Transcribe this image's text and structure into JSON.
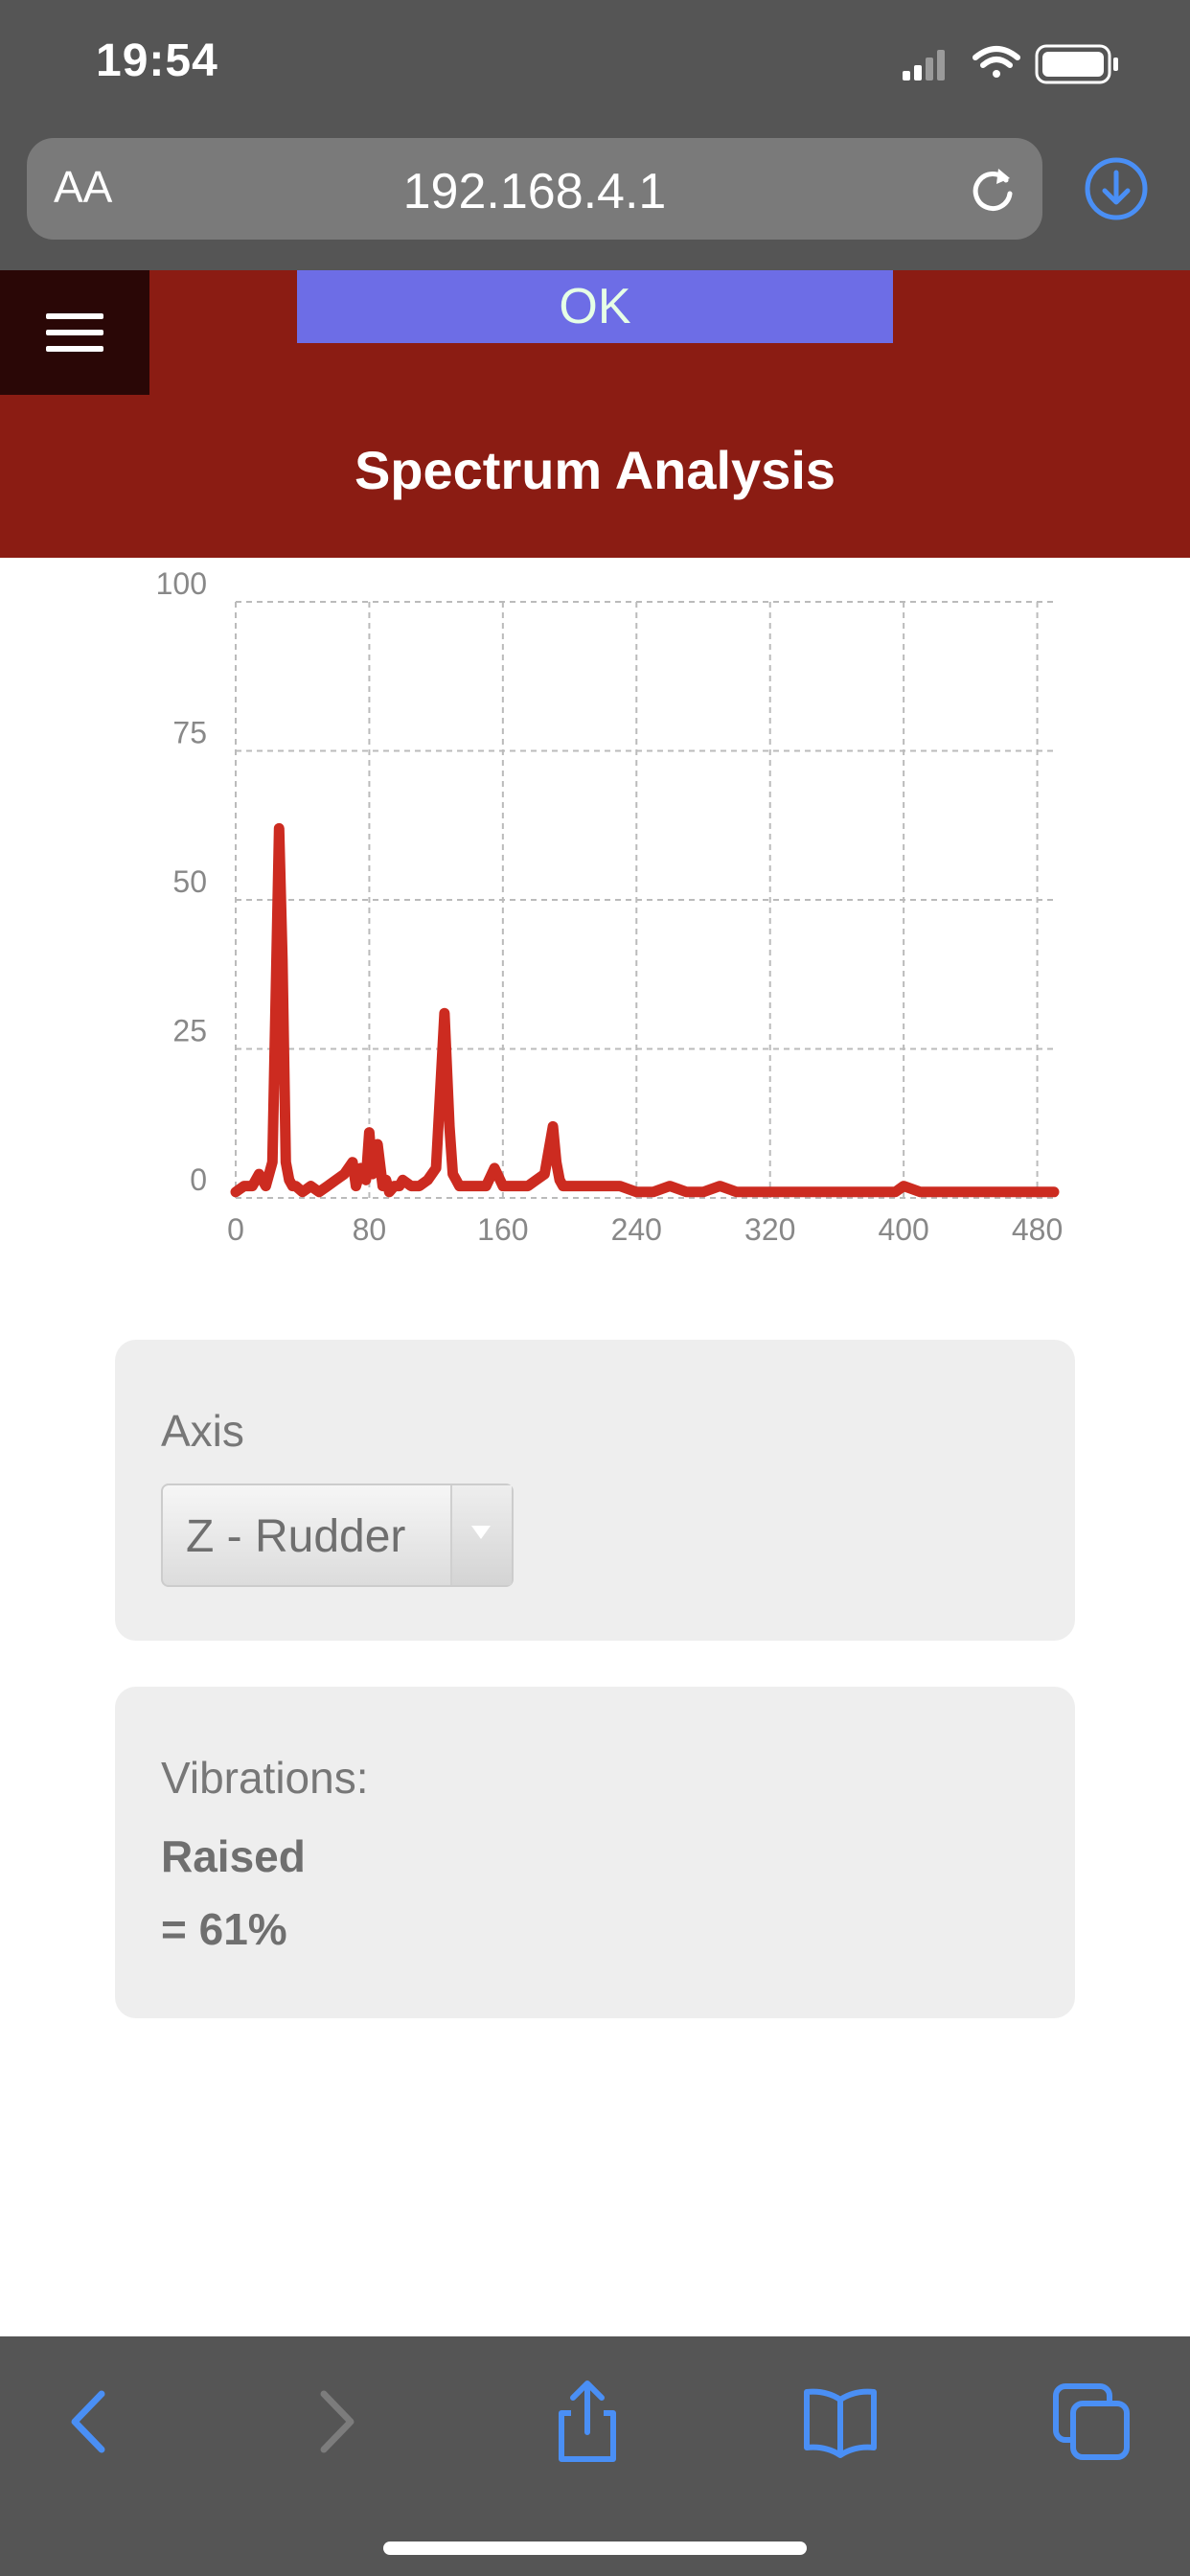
{
  "status_bar": {
    "time": "19:54"
  },
  "browser": {
    "aa_label": "AA",
    "url": "192.168.4.1"
  },
  "header": {
    "ok_label": "OK",
    "title": "Spectrum Analysis"
  },
  "chart_data": {
    "type": "line",
    "title": "",
    "xlabel": "",
    "ylabel": "",
    "xlim": [
      0,
      490
    ],
    "ylim": [
      0,
      100
    ],
    "x_ticks": [
      0,
      80,
      160,
      240,
      320,
      400,
      480
    ],
    "y_ticks": [
      0,
      25,
      50,
      75,
      100
    ],
    "grid": true,
    "color": "#cc2b20",
    "series": [
      {
        "x": [
          0,
          5,
          10,
          14,
          18,
          22,
          26,
          28,
          30,
          32,
          34,
          36,
          40,
          45,
          50,
          55,
          60,
          65,
          70,
          72,
          75,
          78,
          80,
          82,
          85,
          88,
          90,
          92,
          95,
          98,
          100,
          105,
          110,
          115,
          120,
          125,
          128,
          130,
          132,
          134,
          136,
          140,
          145,
          150,
          155,
          160,
          165,
          170,
          175,
          180,
          185,
          190,
          192,
          194,
          196,
          200,
          205,
          210,
          220,
          230,
          240,
          250,
          260,
          270,
          280,
          290,
          300,
          310,
          320,
          330,
          340,
          350,
          360,
          370,
          380,
          390,
          395,
          400,
          410,
          420,
          430,
          440,
          450,
          460,
          470,
          480,
          490
        ],
        "y": [
          1,
          2,
          2,
          4,
          2,
          6,
          62,
          40,
          6,
          3,
          2,
          2,
          1,
          2,
          1,
          2,
          3,
          4,
          6,
          2,
          5,
          3,
          11,
          4,
          9,
          2,
          3,
          1,
          2,
          2,
          3,
          2,
          2,
          3,
          5,
          31,
          12,
          4,
          3,
          2,
          2,
          2,
          2,
          2,
          5,
          2,
          2,
          2,
          2,
          3,
          4,
          12,
          6,
          3,
          2,
          2,
          2,
          2,
          2,
          2,
          1,
          1,
          2,
          1,
          1,
          2,
          1,
          1,
          1,
          1,
          1,
          1,
          1,
          1,
          1,
          1,
          1,
          2,
          1,
          1,
          1,
          1,
          1,
          1,
          1,
          1,
          1
        ]
      }
    ]
  },
  "axis_panel": {
    "label": "Axis",
    "selected": "Z - Rudder"
  },
  "vibration_panel": {
    "label": "Vibrations:",
    "status": "Raised",
    "value": "= 61%"
  }
}
